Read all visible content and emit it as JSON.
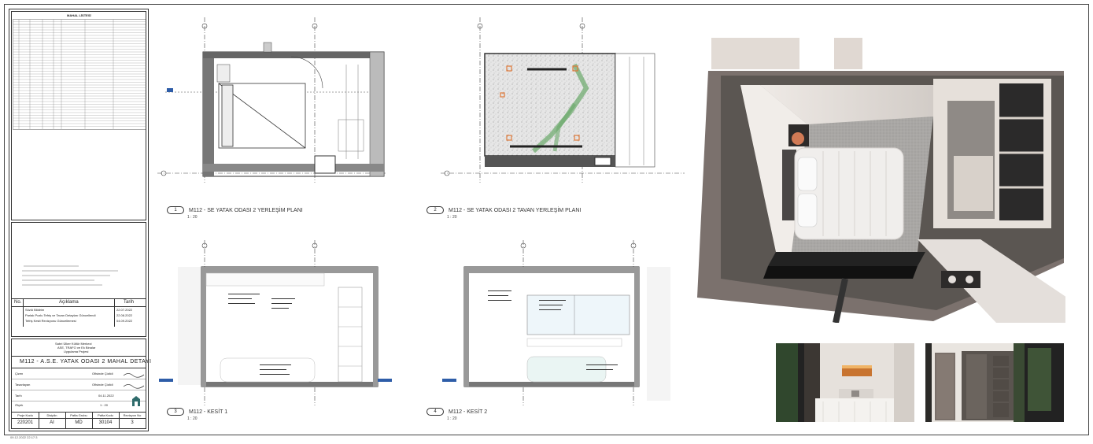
{
  "title_block": {
    "schedule_title": "MAHAL LİSTESİ",
    "notes_col_no": "No.",
    "notes_col_desc": "Açıklama",
    "notes_col_date": "Tarih",
    "revisions": [
      {
        "desc": "Sözlü Bildirim",
        "date": "22.07.2022"
      },
      {
        "desc": "Parlak Pozlu Tefriş ve Tavan Detayları Güncellendi",
        "date": "22.08.2022"
      },
      {
        "desc": "Tefriş Kesit Revizyonu Güncellemesi",
        "date": "04.09.2022"
      }
    ],
    "project_lines": [
      "Sabri Ülker Kültür Merkezi",
      "ASE, TRAFO ve Ek Binalar",
      "Uygulama Projesi"
    ],
    "sheet_title": "M112 - A.S.E. YATAK ODASI 2 MAHAL DETAYI",
    "rows": [
      {
        "label": "Çizen",
        "value": "Ofisinde Çizildi"
      },
      {
        "label": "Tasarlayan",
        "value": "Ofisinde Çizildi"
      },
      {
        "label": "Tarih",
        "value": "04.11.2022"
      },
      {
        "label": "Ölçek",
        "value": "1 : 20"
      }
    ],
    "footer_headers": [
      "Proje Kodu",
      "Disiplin",
      "Pafta Grubu",
      "Pafta Kodu",
      "Revizyon No"
    ],
    "footer_values": [
      "220201",
      "AI",
      "MD",
      "30104",
      "3"
    ],
    "print_stamp": "09.12.2022 22:17:3"
  },
  "views": [
    {
      "num": "1",
      "title": "M112 - SE YATAK ODASI 2 YERLEŞİM PLANI",
      "scale": "1 : 20"
    },
    {
      "num": "2",
      "title": "M112 - SE YATAK ODASI 2 TAVAN YERLEŞİM PLANI",
      "scale": "1 : 20"
    },
    {
      "num": "3",
      "title": "M112 - KESİT 1",
      "scale": "1 : 20"
    },
    {
      "num": "4",
      "title": "M112 - KESİT 2",
      "scale": "1 : 20"
    }
  ],
  "colors": {
    "wall": "#555555",
    "hatch": "#9a9a9a",
    "green": "#6aa86a",
    "orange": "#e07a3a"
  }
}
